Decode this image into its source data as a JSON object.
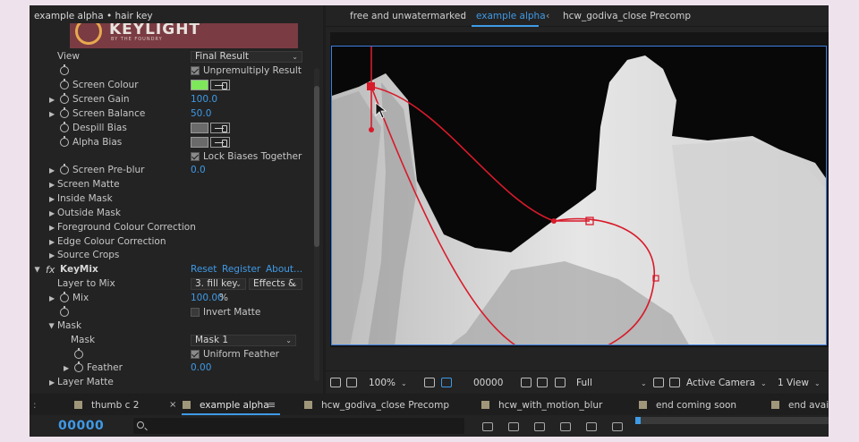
{
  "effect_controls": {
    "title": "example alpha • hair key",
    "banner": {
      "name": "KEYLIGHT",
      "sub": "BY THE FOUNDRY"
    },
    "rows": {
      "view": {
        "label": "View",
        "value": "Final Result"
      },
      "unpremultiply": {
        "label": "Unpremultiply Result"
      },
      "screen_colour": {
        "label": "Screen Colour",
        "color": "#7ee85b"
      },
      "screen_gain": {
        "label": "Screen Gain",
        "value": "100.0"
      },
      "screen_balance": {
        "label": "Screen Balance",
        "value": "50.0"
      },
      "despill_bias": {
        "label": "Despill Bias",
        "color": "#6a6a6a"
      },
      "alpha_bias": {
        "label": "Alpha Bias",
        "color": "#6a6a6a"
      },
      "lock_biases": {
        "label": "Lock Biases Together"
      },
      "screen_preblur": {
        "label": "Screen Pre-blur",
        "value": "0.0"
      },
      "screen_matte": {
        "label": "Screen Matte"
      },
      "inside_mask": {
        "label": "Inside Mask"
      },
      "outside_mask": {
        "label": "Outside Mask"
      },
      "fg_colour_correction": {
        "label": "Foreground Colour Correction"
      },
      "edge_colour_correction": {
        "label": "Edge Colour Correction"
      },
      "source_crops": {
        "label": "Source Crops"
      }
    },
    "keymix": {
      "fx_label": "fx",
      "name": "KeyMix",
      "reset": "Reset",
      "register": "Register",
      "about": "About...",
      "layer_to_mix": {
        "label": "Layer to Mix",
        "value": "3. fill key",
        "source": "Effects &"
      },
      "mix": {
        "label": "Mix",
        "value": "100.00",
        "unit": "%"
      },
      "invert_matte": {
        "label": "Invert Matte"
      },
      "mask_group": {
        "label": "Mask"
      },
      "mask": {
        "label": "Mask",
        "value": "Mask 1"
      },
      "uniform_feather": {
        "label": "Uniform Feather"
      },
      "feather": {
        "label": "Feather",
        "value": "0.00"
      },
      "layer_matte": {
        "label": "Layer Matte"
      }
    }
  },
  "viewer": {
    "breadcrumbs": [
      "free and unwatermarked",
      "example alpha",
      "hcw_godiva_close Precomp"
    ],
    "toolbar": {
      "zoom": "100%",
      "timecode": "00000",
      "resolution": "Full",
      "camera": "Active Camera",
      "views": "1 View"
    }
  },
  "timeline": {
    "tabs": [
      "thumb c 2",
      "example alpha",
      "hcw_godiva_close Precomp",
      "hcw_with_motion_blur",
      "end coming soon",
      "end availa"
    ],
    "timecode": "00000"
  },
  "colors": {
    "accent": "#3f9ae6",
    "mask_path": "#d81a2a",
    "viewer_border": "#3d7fe0"
  }
}
